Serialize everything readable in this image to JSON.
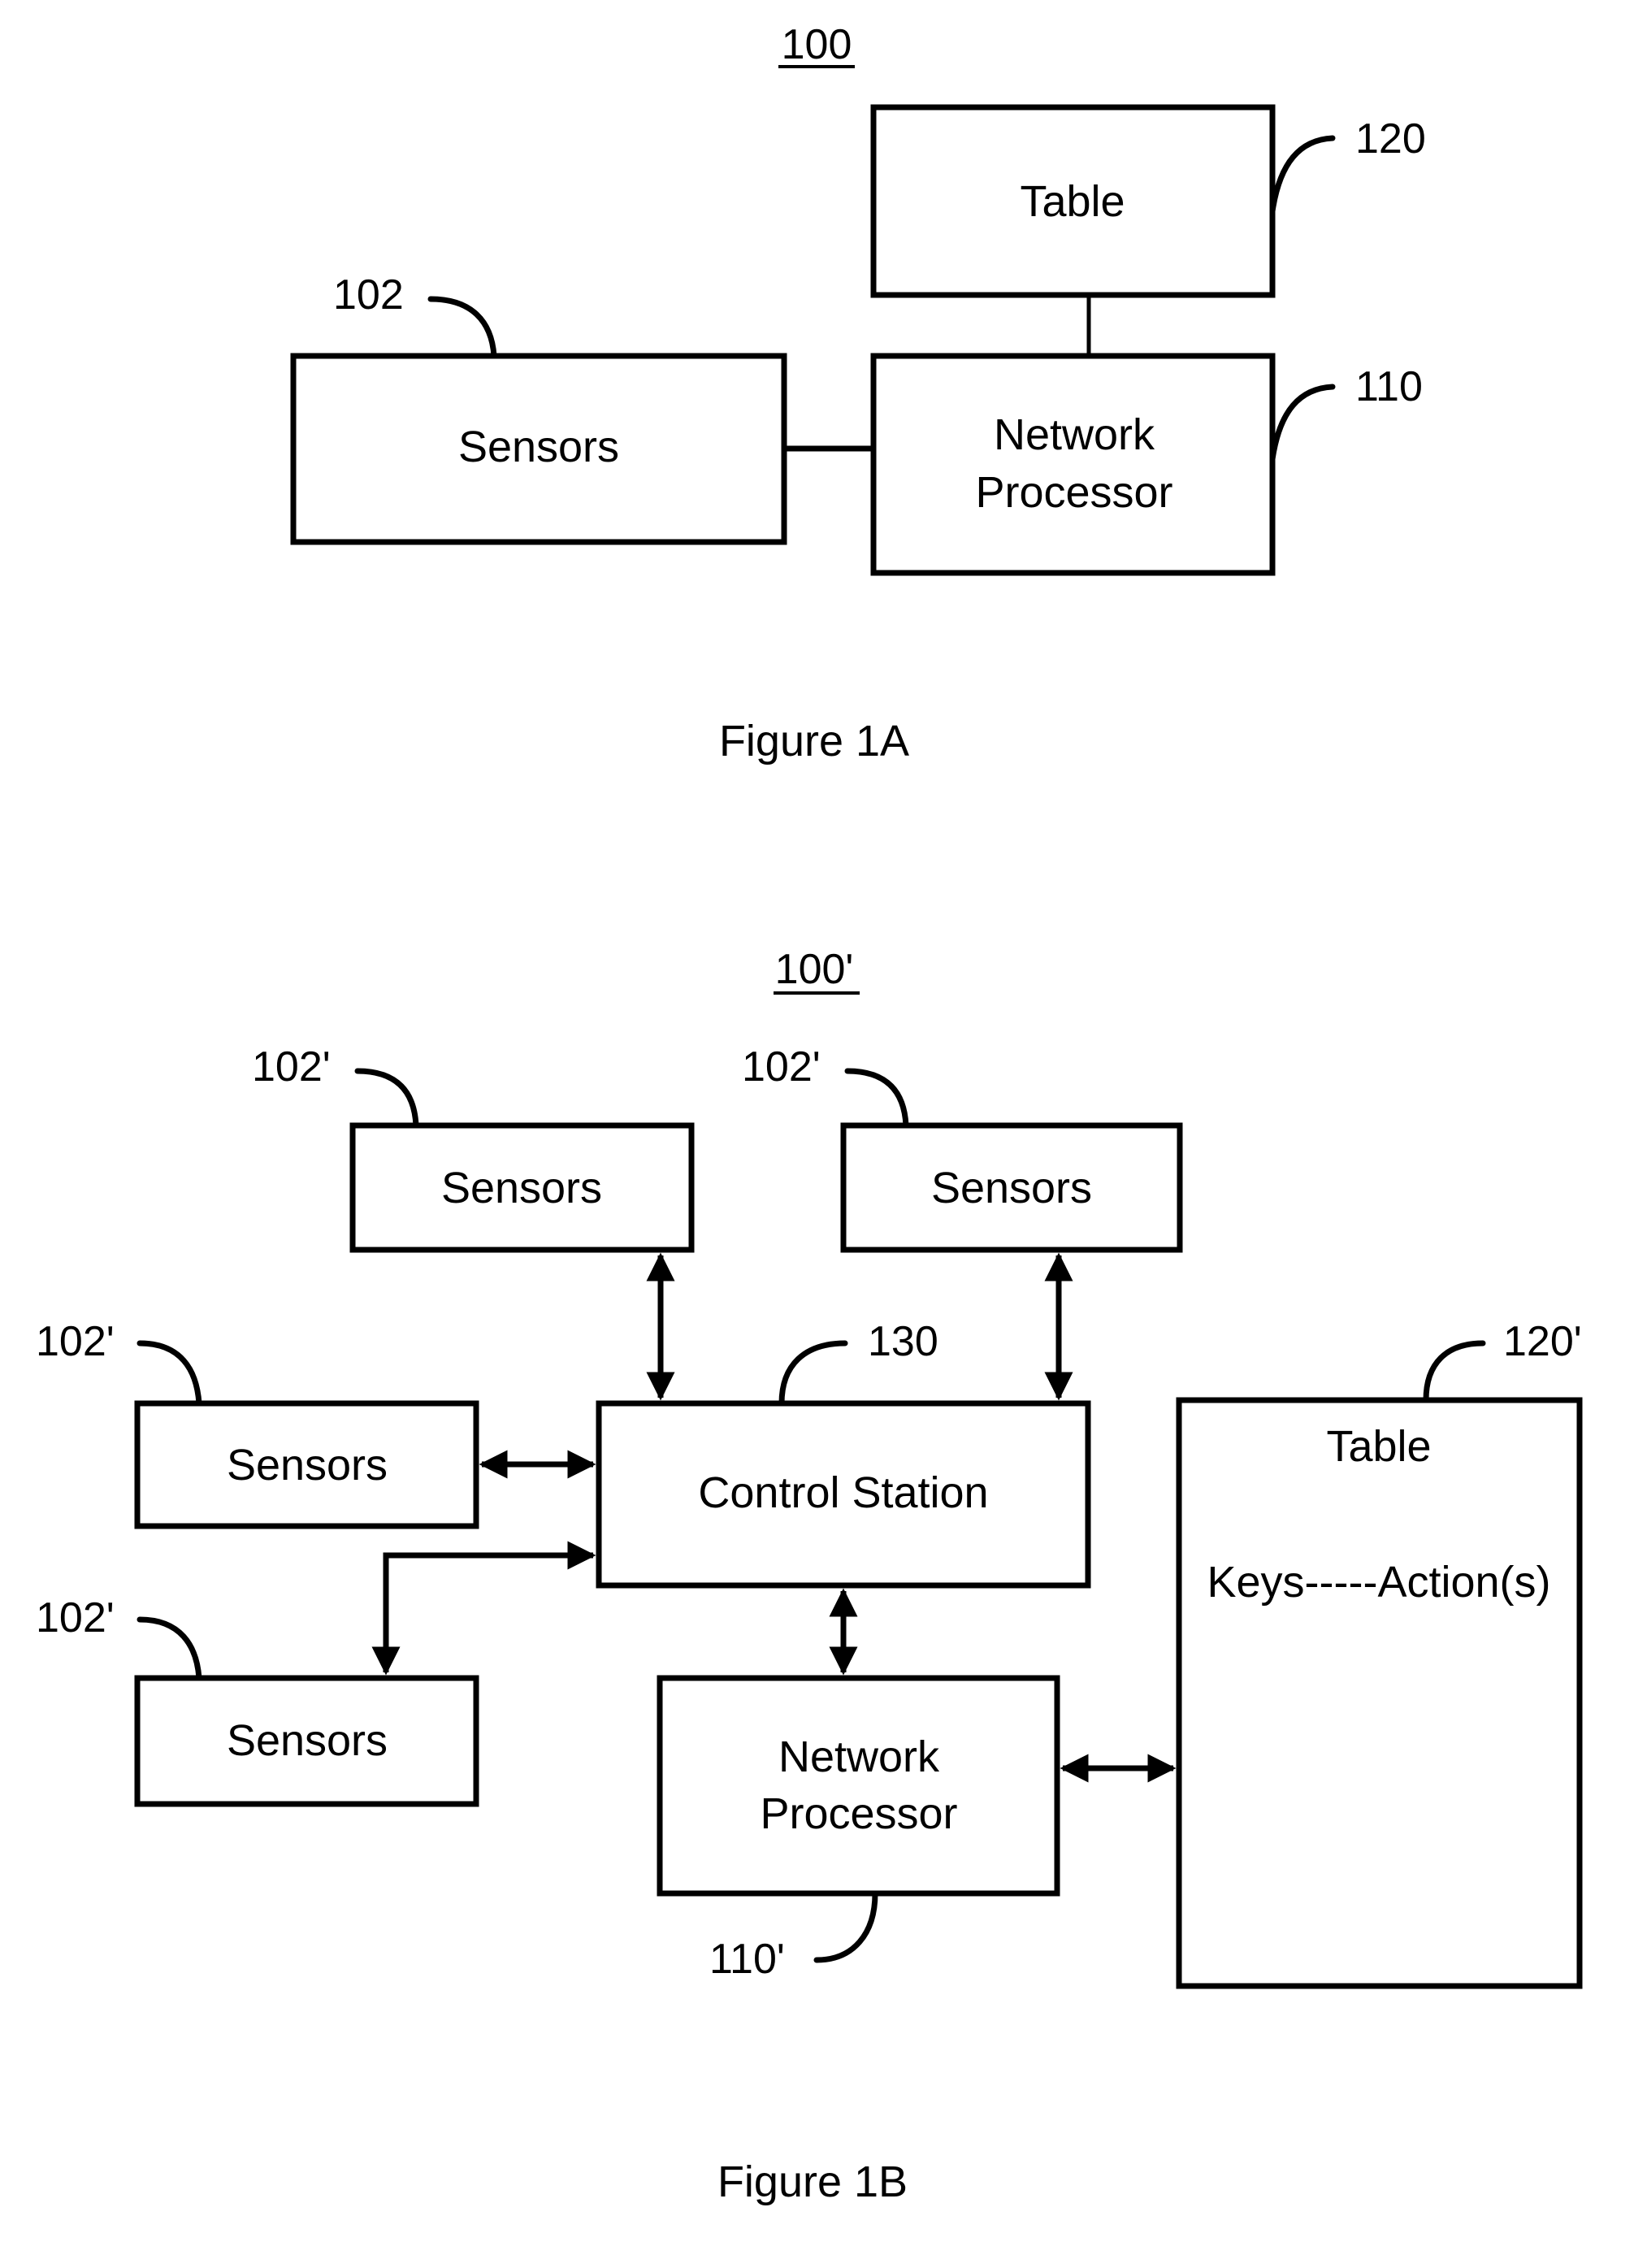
{
  "figure_a": {
    "ref_number": "100",
    "caption": "Figure 1A",
    "blocks": {
      "table": {
        "label": "Table",
        "ref": "120"
      },
      "sensors": {
        "label": "Sensors",
        "ref": "102"
      },
      "network_processor": {
        "label_line1": "Network",
        "label_line2": "Processor",
        "ref": "110"
      }
    }
  },
  "figure_b": {
    "ref_number": "100'",
    "caption": "Figure 1B",
    "blocks": {
      "sensors_top_left": {
        "label": "Sensors",
        "ref": "102'"
      },
      "sensors_top_right": {
        "label": "Sensors",
        "ref": "102'"
      },
      "sensors_middle_left": {
        "label": "Sensors",
        "ref": "102'"
      },
      "sensors_bottom_left": {
        "label": "Sensors",
        "ref": "102'"
      },
      "control_station": {
        "label": "Control Station",
        "ref": "130"
      },
      "network_processor": {
        "label_line1": "Network",
        "label_line2": "Processor",
        "ref": "110'"
      },
      "table": {
        "label": "Table",
        "content": "Keys-----Action(s)",
        "ref": "120'"
      }
    }
  }
}
